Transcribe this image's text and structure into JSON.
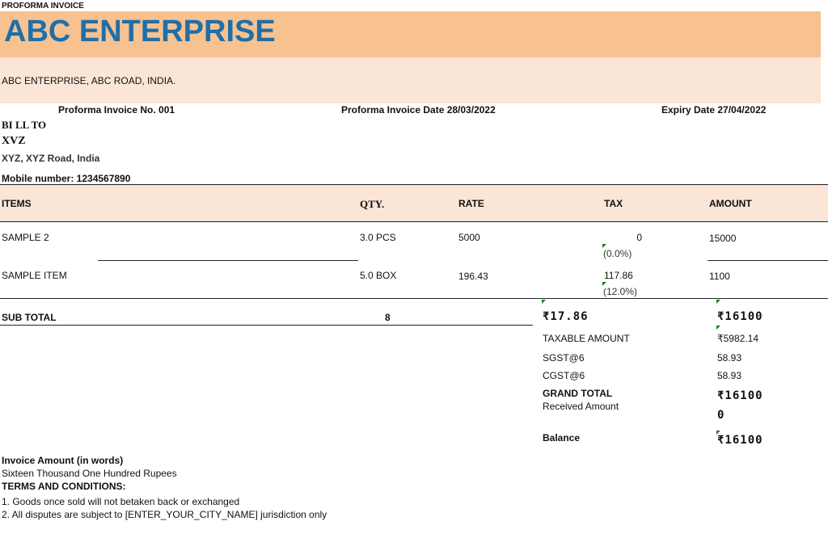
{
  "doc_type": "PROFORMA INVOICE",
  "company": {
    "name": "ABC ENTERPRISE",
    "address": "ABC ENTERPRISE, ABC ROAD, INDIA."
  },
  "invoice": {
    "number_label": "Proforma Invoice No. 001",
    "date_label": "Proforma Invoice Date 28/03/2022",
    "expiry_label": "Expiry Date 27/04/2022"
  },
  "bill_to": {
    "heading": "BI LL TO",
    "name": "XVZ",
    "address": "XYZ, XYZ Road, India",
    "mobile": "Mobile number: 1234567890"
  },
  "table": {
    "headers": [
      "ITEMS",
      "QTY.",
      "RATE",
      "TAX",
      "AMOUNT"
    ],
    "rows": [
      {
        "item": "SAMPLE 2",
        "qty": "3.0 PCS",
        "rate": "5000",
        "tax": "0",
        "tax_pct": "(0.0%)",
        "amount": "15000"
      },
      {
        "item": "SAMPLE ITEM",
        "qty": "5.0 BOX",
        "rate": "196.43",
        "tax": "117.86",
        "tax_pct": "(12.0%)",
        "amount": "1100"
      }
    ]
  },
  "totals": {
    "subtotal_label": "SUB TOTAL",
    "subtotal_qty": "8",
    "subtotal_tax": "₹17.86",
    "subtotal_amount": "₹16100",
    "taxable_label": "TAXABLE AMOUNT",
    "taxable_value": "₹5982.14",
    "sgst_label": "SGST@6",
    "sgst_value": "58.93",
    "cgst_label": "CGST@6",
    "cgst_value": "58.93",
    "grand_total_label": "GRAND TOTAL",
    "grand_total_value": "₹16100",
    "received_label": "Received Amount",
    "received_value": "0",
    "balance_label": "Balance",
    "balance_value": "₹16100"
  },
  "words": {
    "heading": "Invoice Amount (in words)",
    "value": "Sixteen Thousand One Hundred Rupees"
  },
  "terms": {
    "heading": "TERMS AND CONDITIONS:",
    "items": [
      "1. Goods once sold will not betaken back or exchanged",
      "2. All disputes are subject to [ENTER_YOUR_CITY_NAME] jurisdiction only"
    ]
  },
  "colors": {
    "header_band": "#f8c190",
    "light_band": "#fbe5d6",
    "company_name": "#1f6fa8",
    "marker": "#1f7a1f"
  }
}
